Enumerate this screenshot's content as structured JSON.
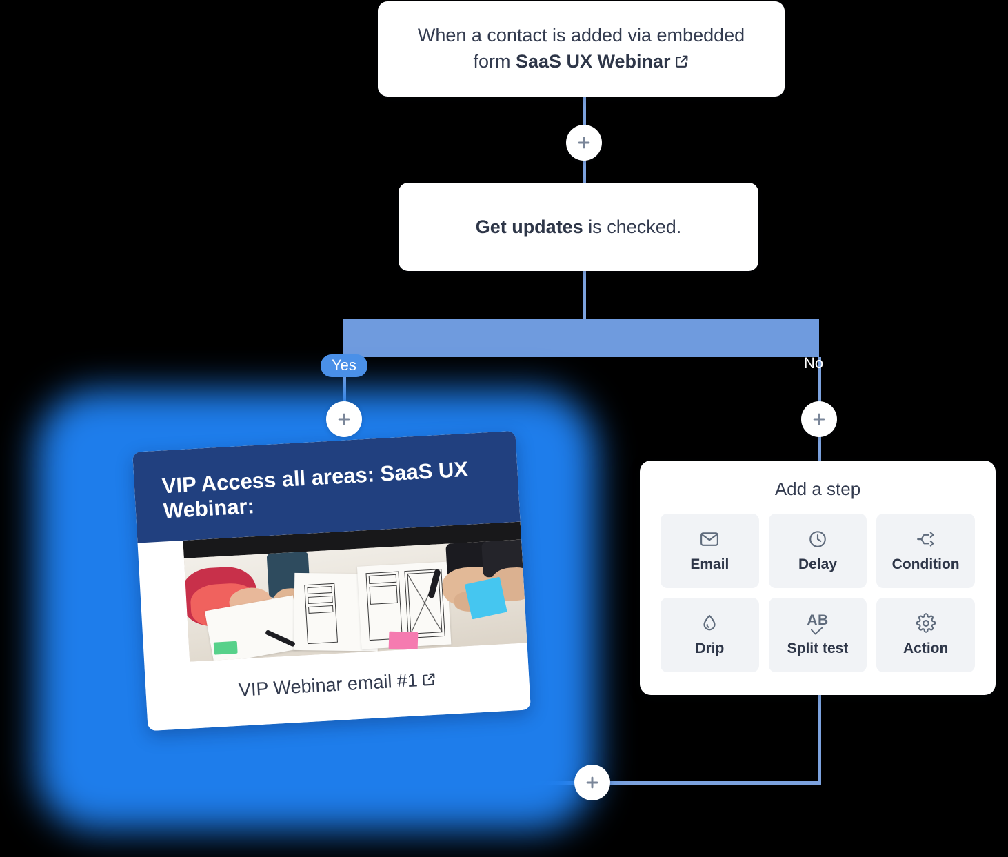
{
  "flow": {
    "trigger": {
      "text_prefix": "When a contact is added via embedded form ",
      "text_bold": "SaaS UX Webinar",
      "link_icon": "external-link-icon"
    },
    "condition": {
      "text_bold": "Get updates",
      "text_suffix": " is checked."
    },
    "branches": {
      "yes_label": "Yes",
      "no_label": "No"
    },
    "add_buttons": {
      "glyph": "+",
      "name": "plus-icon"
    }
  },
  "email_step": {
    "header": "VIP Access all areas: SaaS UX Webinar:",
    "footer": "VIP Webinar email #1",
    "link_icon": "external-link-icon",
    "image_alt": "people-collaborating-on-wireframes-photo"
  },
  "add_step_panel": {
    "title": "Add a step",
    "options": [
      {
        "label": "Email",
        "icon": "envelope-icon"
      },
      {
        "label": "Delay",
        "icon": "clock-icon"
      },
      {
        "label": "Condition",
        "icon": "branch-shuffle-icon"
      },
      {
        "label": "Drip",
        "icon": "droplet-icon"
      },
      {
        "label": "Split test",
        "icon": "ab-check-icon"
      },
      {
        "label": "Action",
        "icon": "gear-icon"
      }
    ]
  },
  "colors": {
    "connector": "#7CA2DE",
    "branch_bar": "#6F9BDE",
    "yes_pill": "#4A90E8",
    "glow": "#1E7DEB",
    "email_header": "#21407F",
    "text": "#333B4F",
    "panel_tile": "#F1F3F6"
  }
}
